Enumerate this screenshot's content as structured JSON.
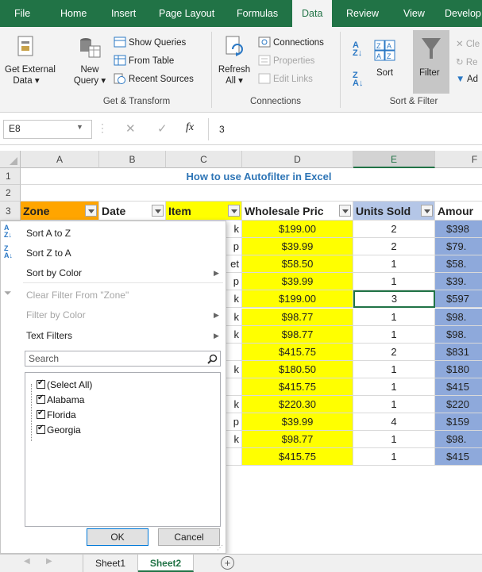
{
  "ribbon_tabs": [
    "File",
    "Home",
    "Insert",
    "Page Layout",
    "Formulas",
    "Data",
    "Review",
    "View",
    "Develop"
  ],
  "active_tab": "Data",
  "ribbon": {
    "get_external_data": [
      "Get External",
      "Data ▾"
    ],
    "new_query": [
      "New",
      "Query ▾"
    ],
    "show_queries": "Show Queries",
    "from_table": "From Table",
    "recent_sources": "Recent Sources",
    "group_get_transform": "Get & Transform",
    "refresh_all": [
      "Refresh",
      "All ▾"
    ],
    "connections": "Connections",
    "properties": "Properties",
    "edit_links": "Edit Links",
    "group_connections": "Connections",
    "sort": "Sort",
    "filter": "Filter",
    "clear_partial": "Cle",
    "reapply_partial": "Re",
    "advanced_partial": "Ad",
    "group_sort_filter": "Sort & Filter"
  },
  "formula_bar": {
    "name_box": "E8",
    "fx": "fx",
    "value": "3"
  },
  "columns": [
    "A",
    "B",
    "C",
    "D",
    "E",
    "F"
  ],
  "rows": [
    "1",
    "2",
    "3"
  ],
  "title": "How to use Autofilter in Excel",
  "headers": [
    "Zone",
    "Date",
    "Item",
    "Wholesale Pric",
    "Units Sold",
    "Amour"
  ],
  "col_c_partial": [
    "k",
    "p",
    "et",
    "p",
    "k",
    "k",
    "k",
    "",
    "k",
    "",
    "k",
    "p",
    "k",
    ""
  ],
  "wholesale": [
    "$199.00",
    "$39.99",
    "$58.50",
    "$39.99",
    "$199.00",
    "$98.77",
    "$98.77",
    "$415.75",
    "$180.50",
    "$415.75",
    "$220.30",
    "$39.99",
    "$98.77",
    "$415.75"
  ],
  "units": [
    "2",
    "2",
    "1",
    "1",
    "3",
    "1",
    "1",
    "2",
    "1",
    "1",
    "1",
    "4",
    "1",
    "1"
  ],
  "amount_partial": [
    "$398",
    "$79.",
    "$58.",
    "$39.",
    "$597",
    "$98.",
    "$98.",
    "$831",
    "$180",
    "$415",
    "$220",
    "$159",
    "$98.",
    "$415"
  ],
  "filter_menu": {
    "sort_az": "Sort A to Z",
    "sort_za": "Sort Z to A",
    "sort_by_color": "Sort by Color",
    "clear_filter": "Clear Filter From \"Zone\"",
    "filter_by_color": "Filter by Color",
    "text_filters": "Text Filters",
    "search_placeholder": "Search",
    "items": [
      "(Select All)",
      "Alabama",
      "Florida",
      "Georgia"
    ],
    "ok": "OK",
    "cancel": "Cancel"
  },
  "sheets": [
    "Sheet1",
    "Sheet2"
  ],
  "active_sheet": "Sheet2",
  "colors": {
    "excel_green": "#217346",
    "header_orange": "#ffa500",
    "yellow": "#ffff00",
    "blue_col": "#8ea9db",
    "units_header": "#b4c6e7"
  }
}
